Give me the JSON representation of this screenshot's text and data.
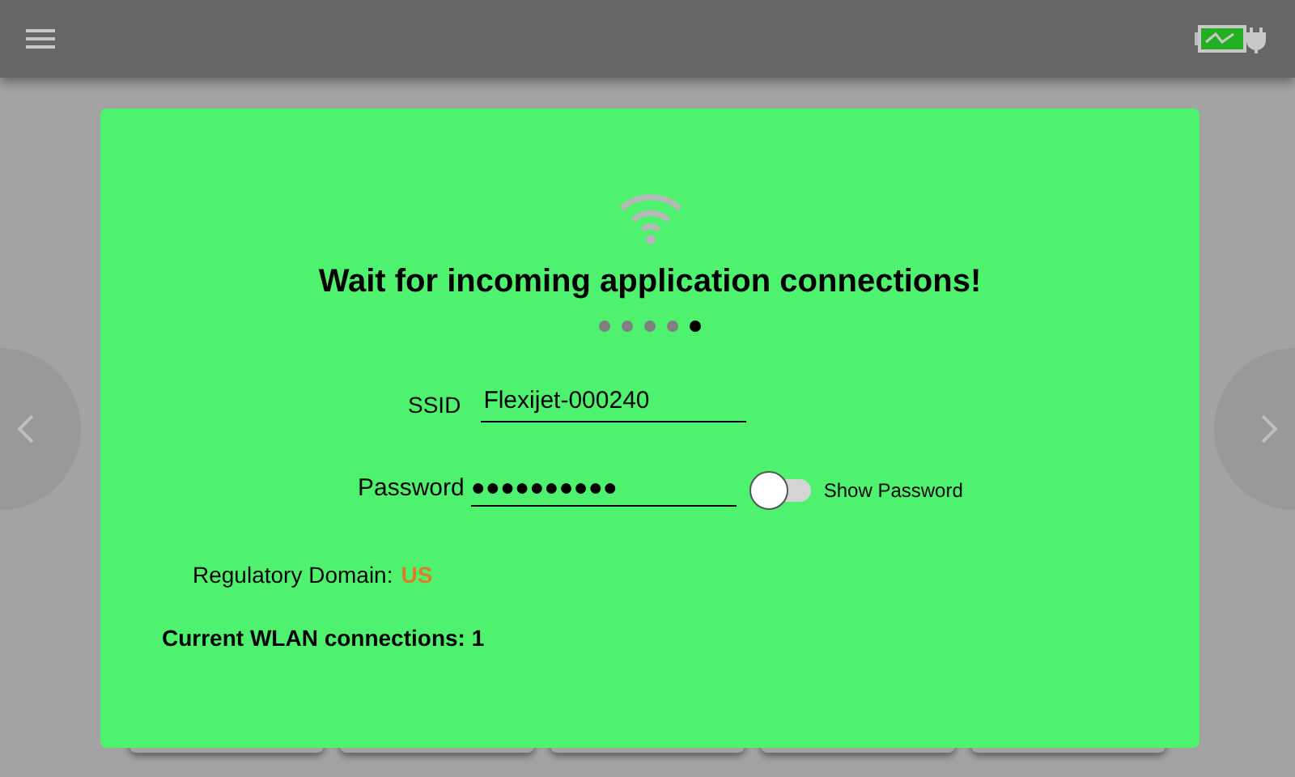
{
  "dialog": {
    "title": "Wait for incoming application connections!",
    "progress_dots": [
      {
        "selected": false
      },
      {
        "selected": false
      },
      {
        "selected": false
      },
      {
        "selected": false
      },
      {
        "selected": true
      }
    ],
    "ssid": {
      "label": "SSID",
      "value": "Flexijet-000240"
    },
    "password": {
      "label": "Password",
      "value": "●●●●●●●●●●"
    },
    "show_password": {
      "label": "Show Password",
      "checked": false
    },
    "regulatory_domain": {
      "label": "Regulatory Domain:",
      "value": "US"
    },
    "connections": "Current WLAN connections: 1"
  }
}
